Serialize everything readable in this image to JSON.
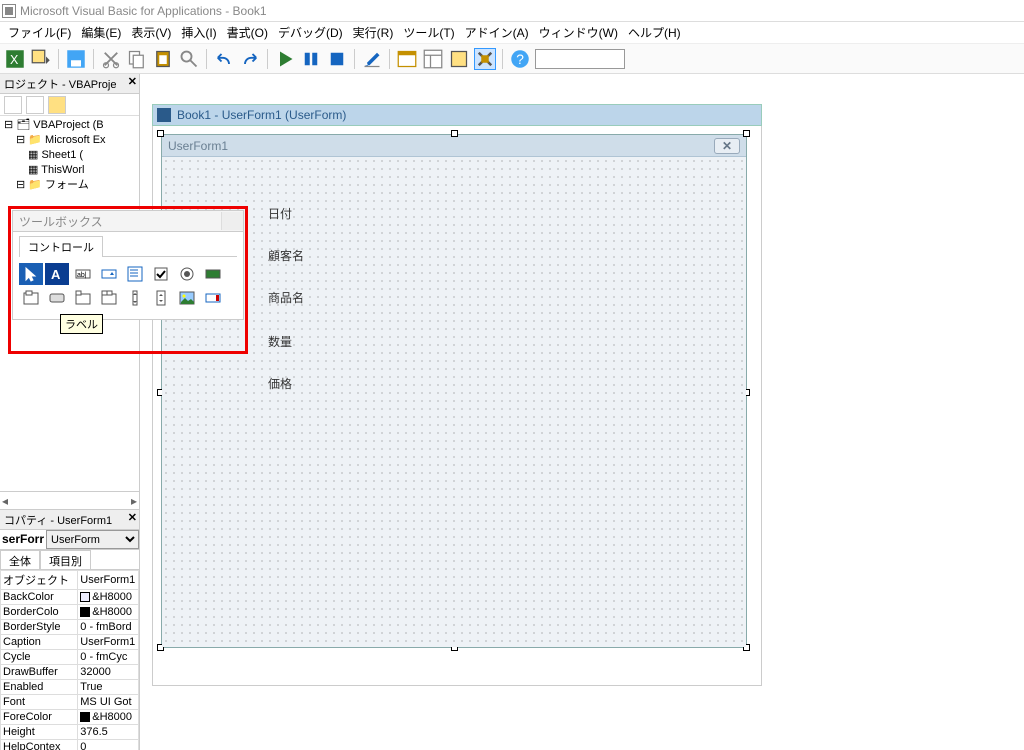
{
  "app_title": "Microsoft Visual Basic for Applications - Book1",
  "menus": {
    "file": "ファイル(F)",
    "edit": "編集(E)",
    "view": "表示(V)",
    "insert": "挿入(I)",
    "format": "書式(O)",
    "debug": "デバッグ(D)",
    "run": "実行(R)",
    "tools": "ツール(T)",
    "addin": "アドイン(A)",
    "window": "ウィンドウ(W)",
    "help": "ヘルプ(H)"
  },
  "project_pane": {
    "title": "ロジェクト - VBAProje",
    "nodes": {
      "root": "VBAProject (B",
      "excel": "Microsoft Ex",
      "sheet1": "Sheet1 (",
      "thiswb": "ThisWorl",
      "forms": "フォーム"
    }
  },
  "properties_pane": {
    "title": "コパティ - UserForm1",
    "object_bold": "serForr",
    "object_sel": "UserForm",
    "tabs": {
      "all": "全体",
      "cat": "項目別"
    },
    "rows": [
      {
        "k": "オブジェクト",
        "v": "UserForm1"
      },
      {
        "k": "BackColor",
        "v": "&H8000"
      },
      {
        "k": "BorderColo",
        "v": "&H8000"
      },
      {
        "k": "BorderStyle",
        "v": "0 - fmBord"
      },
      {
        "k": "Caption",
        "v": "UserForm1"
      },
      {
        "k": "Cycle",
        "v": "0 - fmCyc"
      },
      {
        "k": "DrawBuffer",
        "v": "32000"
      },
      {
        "k": "Enabled",
        "v": "True"
      },
      {
        "k": "Font",
        "v": "MS UI Got"
      },
      {
        "k": "ForeColor",
        "v": "&H8000"
      },
      {
        "k": "Height",
        "v": "376.5"
      },
      {
        "k": "HelpContex",
        "v": "0"
      }
    ]
  },
  "designer": {
    "doc_title": "Book1 - UserForm1 (UserForm)",
    "form_caption": "UserForm1",
    "labels": [
      "日付",
      "顧客名",
      "商品名",
      "数量",
      "価格"
    ]
  },
  "toolbox": {
    "title": "ツールボックス",
    "tab": "コントロール",
    "tooltip": "ラベル"
  }
}
